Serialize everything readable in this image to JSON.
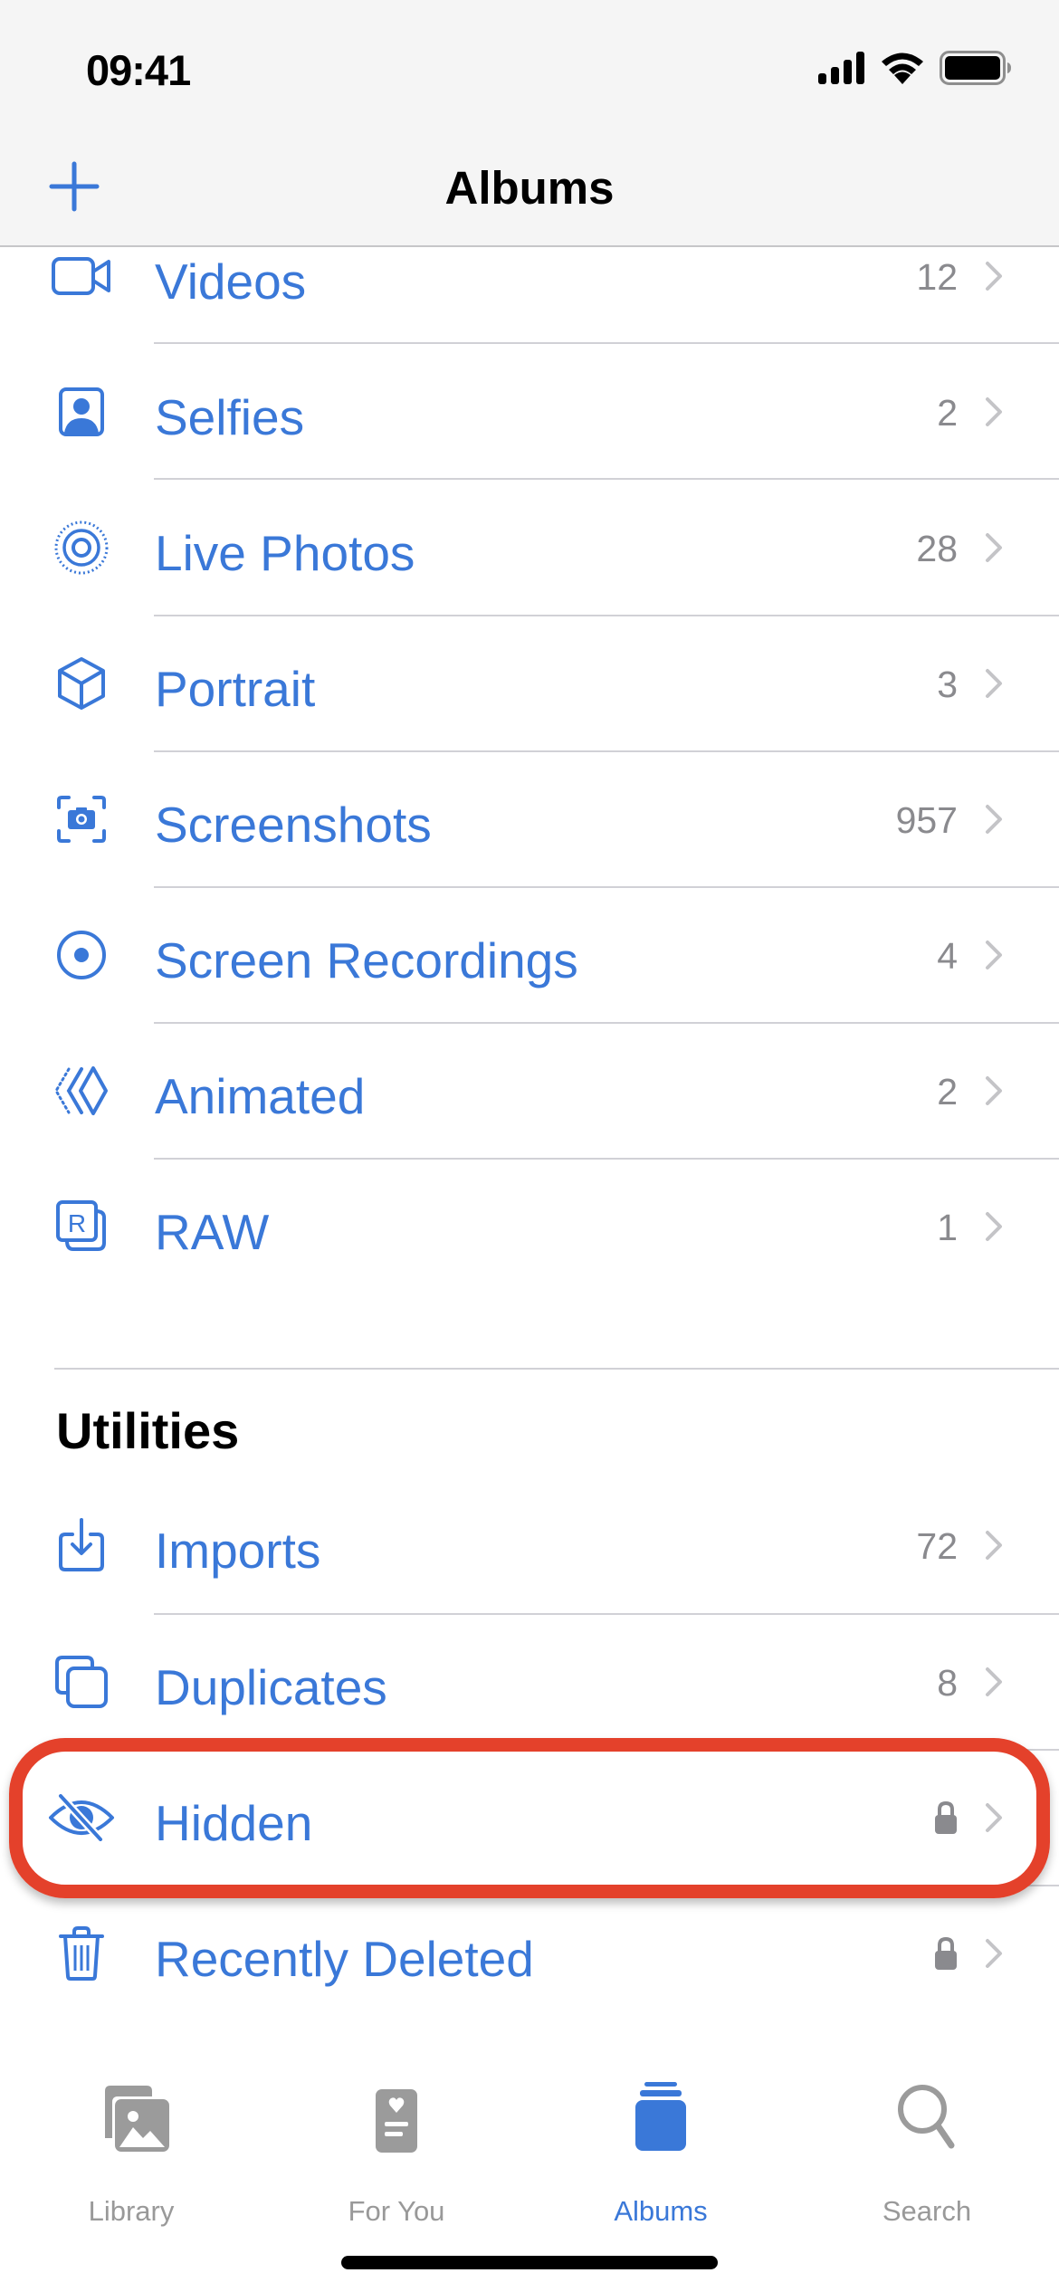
{
  "status_bar": {
    "time": "09:41",
    "icons": [
      "cellular-signal-icon",
      "wifi-icon",
      "battery-icon"
    ]
  },
  "nav": {
    "title": "Albums",
    "add_button": "plus-icon"
  },
  "media_types": [
    {
      "label": "Videos",
      "count": "12",
      "icon": "video-camera-icon"
    },
    {
      "label": "Selfies",
      "count": "2",
      "icon": "person-portrait-icon"
    },
    {
      "label": "Live Photos",
      "count": "28",
      "icon": "live-photo-icon"
    },
    {
      "label": "Portrait",
      "count": "3",
      "icon": "cube-icon"
    },
    {
      "label": "Screenshots",
      "count": "957",
      "icon": "screenshot-camera-icon"
    },
    {
      "label": "Screen Recordings",
      "count": "4",
      "icon": "record-circle-icon"
    },
    {
      "label": "Animated",
      "count": "2",
      "icon": "animated-layers-icon"
    },
    {
      "label": "RAW",
      "count": "1",
      "icon": "raw-icon"
    }
  ],
  "utilities": {
    "title": "Utilities",
    "items": [
      {
        "label": "Imports",
        "count": "72",
        "icon": "import-tray-icon"
      },
      {
        "label": "Duplicates",
        "count": "8",
        "icon": "duplicate-squares-icon"
      },
      {
        "label": "Hidden",
        "locked": true,
        "icon": "eye-slash-icon",
        "highlighted": true
      },
      {
        "label": "Recently Deleted",
        "locked": true,
        "icon": "trash-icon"
      }
    ]
  },
  "tabs": [
    {
      "label": "Library",
      "icon": "photo-stack-icon",
      "active": false
    },
    {
      "label": "For You",
      "icon": "for-you-card-icon",
      "active": false
    },
    {
      "label": "Albums",
      "icon": "albums-stack-icon",
      "active": true
    },
    {
      "label": "Search",
      "icon": "magnifier-icon",
      "active": false
    }
  ],
  "colors": {
    "accent": "#3a78d8",
    "highlight": "#e4412b",
    "secondary_text": "#8a8a8e",
    "inactive_tab": "#999999"
  }
}
